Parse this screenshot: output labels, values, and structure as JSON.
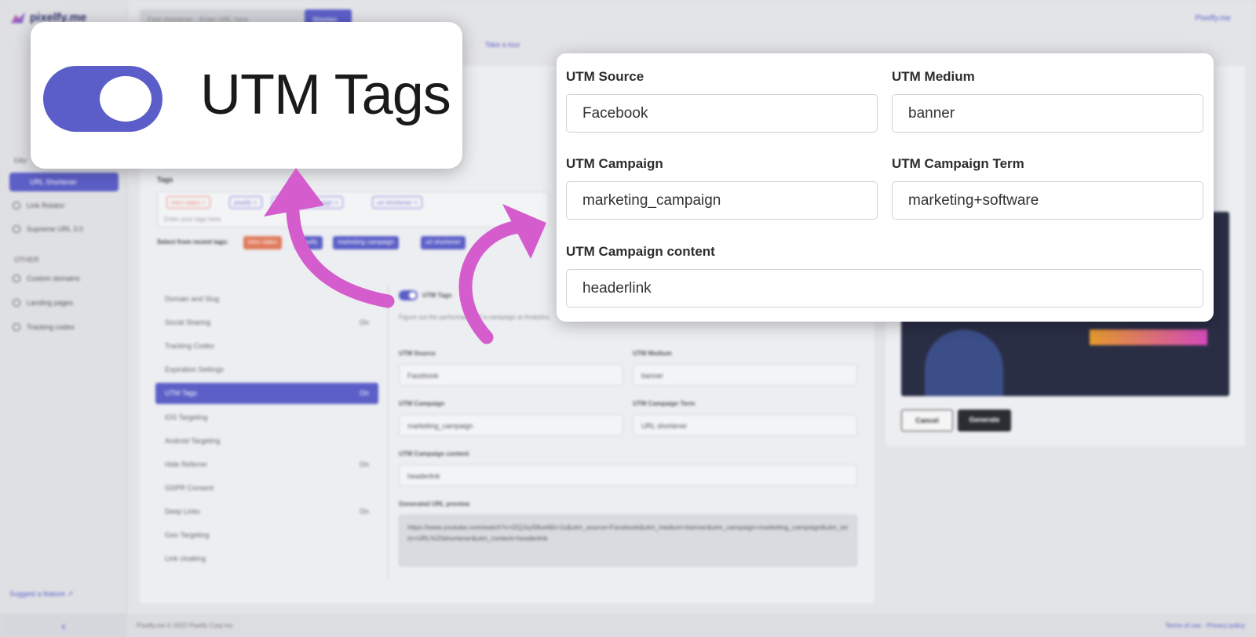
{
  "app": {
    "brand": "pixelfy.me",
    "top_search_placeholder": "Fast shortener - Enter URL here",
    "top_search_button": "Shorten",
    "account": "Pixelfy.me",
    "tour": "Take a tour"
  },
  "sidebar": {
    "section_fav": "FAV",
    "active_item": "URL Shortener",
    "items": [
      "Link Rotator",
      "Supreme URL 3.0"
    ],
    "section_other": "OTHER",
    "other_items": [
      "Custom domains",
      "Landing pages",
      "Tracking codes"
    ],
    "suggest": "Suggest a feature"
  },
  "tags": {
    "label": "Tags",
    "chips": [
      "intro video ×",
      "pixelfy ×",
      "marketing campaign ×",
      "url shortener ×"
    ],
    "input_placeholder": "Enter your tags here",
    "recent_label": "Select from recent tags:",
    "recent_chips": [
      "intro video",
      "pixelfy",
      "marketing campaign",
      "url shortener"
    ]
  },
  "left_menu": {
    "items": [
      {
        "label": "Domain and Slug",
        "state": ""
      },
      {
        "label": "Social Sharing",
        "state": "On"
      },
      {
        "label": "Tracking Codes",
        "state": ""
      },
      {
        "label": "Expiration Settings",
        "state": ""
      },
      {
        "label": "UTM Tags",
        "state": "On"
      },
      {
        "label": "iOS Targeting",
        "state": ""
      },
      {
        "label": "Android Targeting",
        "state": ""
      },
      {
        "label": "Hide Referrer",
        "state": "On"
      },
      {
        "label": "GDPR Consent",
        "state": ""
      },
      {
        "label": "Deep Links",
        "state": "On"
      },
      {
        "label": "Geo Targeting",
        "state": ""
      },
      {
        "label": "Link cloaking",
        "state": ""
      }
    ]
  },
  "utm_panel": {
    "title": "UTM Tags",
    "description": "Figure out the performance of a campaign at Analytics.",
    "source_label": "UTM Source",
    "source_value": "Facebook",
    "medium_label": "UTM Medium",
    "medium_value": "banner",
    "campaign_label": "UTM Campaign",
    "campaign_value": "marketing_campaign",
    "term_label": "UTM Campaign Term",
    "term_value": "URL shortener",
    "content_label": "UTM Campaign content",
    "content_value": "headerlink",
    "preview_label": "Generated URL preview",
    "preview_value": "https://www.youtube.com/watch?v=l2QJzy58vell&t=1s&utm_source=Facebook&utm_medium=banner&utm_campaign=marketing_campaign&utm_term=URL%20shortener&utm_content=headerlink"
  },
  "actions": {
    "cancel": "Cancel",
    "generate": "Generate"
  },
  "footer": {
    "left": "Pixelfy.me © 2022 Pixelfy Corp Inc.",
    "right": "Terms of use - Privacy policy"
  },
  "callout_toggle": {
    "title": "UTM Tags",
    "enabled": true
  },
  "callout_form": {
    "source_label": "UTM Source",
    "source_value": "Facebook",
    "medium_label": "UTM Medium",
    "medium_value": "banner",
    "campaign_label": "UTM Campaign",
    "campaign_value": "marketing_campaign",
    "term_label": "UTM Campaign Term",
    "term_value": "marketing+software",
    "content_label": "UTM Campaign content",
    "content_value": "headerlink"
  },
  "colors": {
    "accent": "#5b5ec8",
    "arrow": "#d45ccc",
    "tag_red": "#e07b5d"
  },
  "icons": [
    "pixelfy-logo-icon",
    "url-shortener-icon",
    "link-rotator-icon",
    "supreme-url-icon",
    "home-icon",
    "landing-pages-icon",
    "code-icon",
    "external-link-icon",
    "chevron-left-icon",
    "curved-arrow-icon"
  ]
}
